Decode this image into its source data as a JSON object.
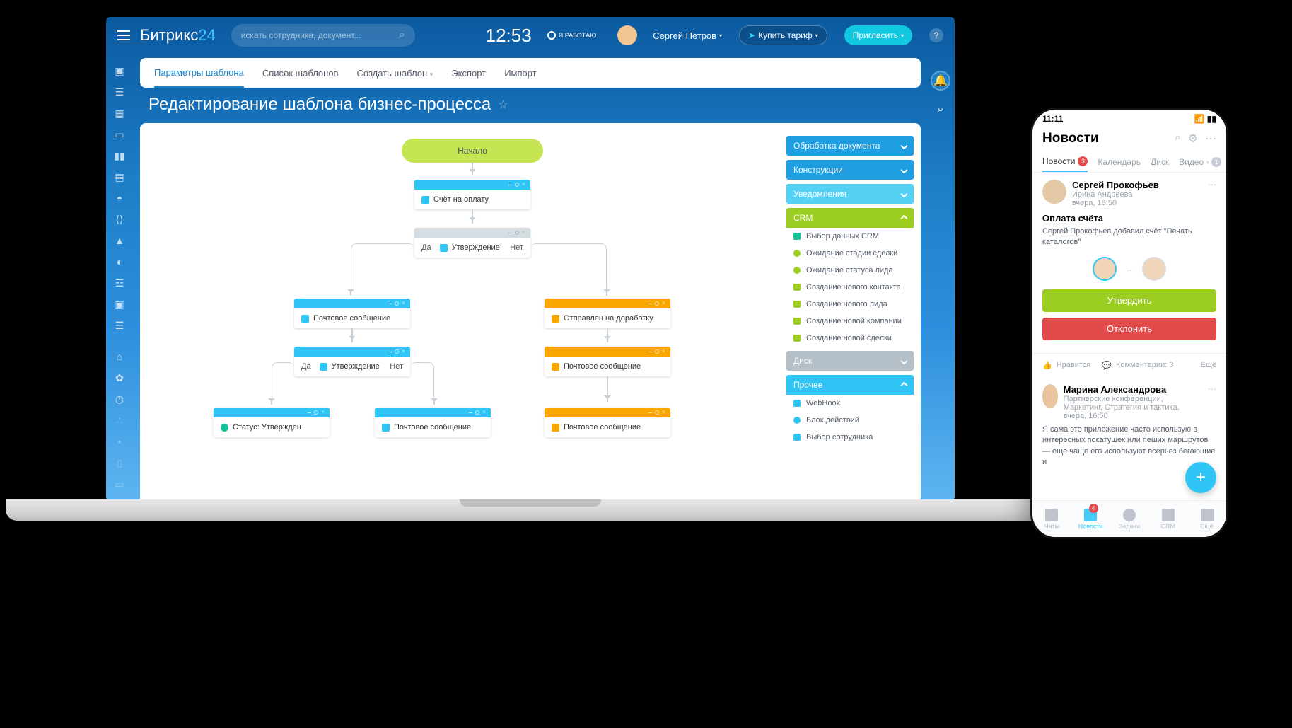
{
  "topbar": {
    "logo_a": "Битрикс",
    "logo_b": "24",
    "search_placeholder": "искать сотрудника, документ...",
    "clock": "12:53",
    "work_badge": "Я РАБОТАЮ",
    "user_name": "Сергей Петров",
    "buy_label": "Купить тариф",
    "invite_label": "Пригласить"
  },
  "tabs": {
    "params": "Параметры шаблона",
    "list": "Список шаблонов",
    "create": "Создать шаблон",
    "export": "Экспорт",
    "import": "Импорт"
  },
  "page_title": "Редактирование шаблона бизнес-процесса",
  "flow": {
    "start": "Начало",
    "invoice": "Счёт на оплату",
    "yes": "Да",
    "no": "Нет",
    "approval": "Утверждение",
    "mail": "Почтовое сообщение",
    "rework": "Отправлен на доработку",
    "status_approved": "Статус: Утвержден"
  },
  "palette": {
    "doc": "Обработка документа",
    "constr": "Конструкции",
    "notif": "Уведомления",
    "crm": "CRM",
    "crm_items": {
      "i0": "Выбор данных CRM",
      "i1": "Ожидание стадии сделки",
      "i2": "Ожидание статуса лида",
      "i3": "Создание нового контакта",
      "i4": "Создание нового лида",
      "i5": "Создание новой компании",
      "i6": "Создание новой сделки"
    },
    "disk": "Диск",
    "other": "Прочее",
    "other_items": {
      "i0": "WebHook",
      "i1": "Блок действий",
      "i2": "Выбор сотрудника"
    }
  },
  "phone": {
    "time": "11:11",
    "title": "Новости",
    "tabs": {
      "news": "Новости",
      "news_badge": "3",
      "cal": "Календарь",
      "disk": "Диск",
      "video": "Видео",
      "video_badge": "1"
    },
    "post1": {
      "name": "Сергей Прокофьев",
      "sub": "Ирина Андреева",
      "time": "вчера, 16:50",
      "title": "Оплата счёта",
      "text": "Сергей Прокофьев добавил счёт \"Печать каталогов\"",
      "approve": "Утвердить",
      "reject": "Отклонить"
    },
    "actions": {
      "like": "Нравится",
      "comments": "Комментарии: 3",
      "more": "Ещё"
    },
    "post2": {
      "name": "Марина Александрова",
      "sub": "Партнерские конференции, Маркетинг, Стратегия и тактика,",
      "time": "вчера, 16:50",
      "text": "Я сама это приложение часто использую в интересных покатушек или пеших маршрутов — еще чаще его используют всерьез бегающие и"
    },
    "bottom": {
      "chats": "Чаты",
      "news": "Новости",
      "news_badge": "4",
      "tasks": "Задачи",
      "crm": "CRM",
      "more": "Ещё"
    }
  }
}
